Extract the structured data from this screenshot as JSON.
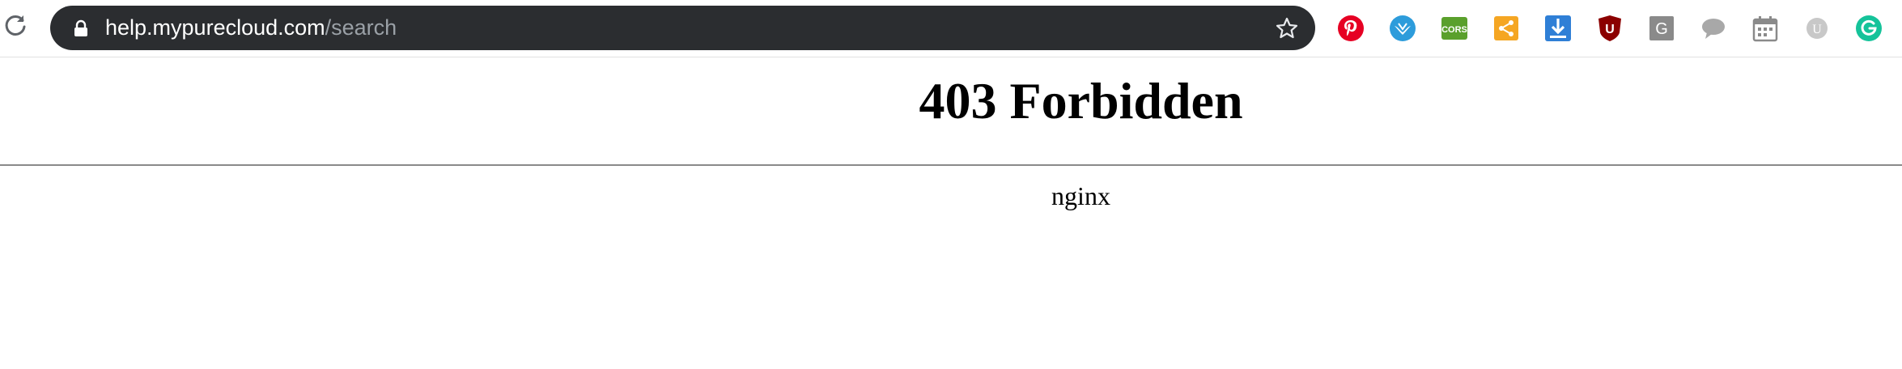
{
  "browser": {
    "url_host": "help.mypurecloud.com",
    "url_path": "/search",
    "extensions": [
      {
        "name": "pinterest-icon",
        "color": "#e60023"
      },
      {
        "name": "extension-bird-icon",
        "color": "#2d9cdb"
      },
      {
        "name": "cors-icon",
        "label": "CORS",
        "color": "#5aa02c"
      },
      {
        "name": "share-icon",
        "color": "#f5a623"
      },
      {
        "name": "download-icon",
        "color": "#2f7fd6"
      },
      {
        "name": "ublock-icon",
        "label": "U",
        "color": "#8b0000"
      },
      {
        "name": "g-extension-icon",
        "label": "G",
        "color": "#8a8a8a"
      },
      {
        "name": "chat-icon",
        "color": "#9a9a9a"
      },
      {
        "name": "calendar-icon",
        "color": "#9a9a9a"
      },
      {
        "name": "u-extension-icon",
        "label": "U",
        "color": "#b0b0b0"
      },
      {
        "name": "grammarly-icon",
        "color": "#15c39a"
      }
    ]
  },
  "page": {
    "title": "403 Forbidden",
    "server": "nginx"
  }
}
